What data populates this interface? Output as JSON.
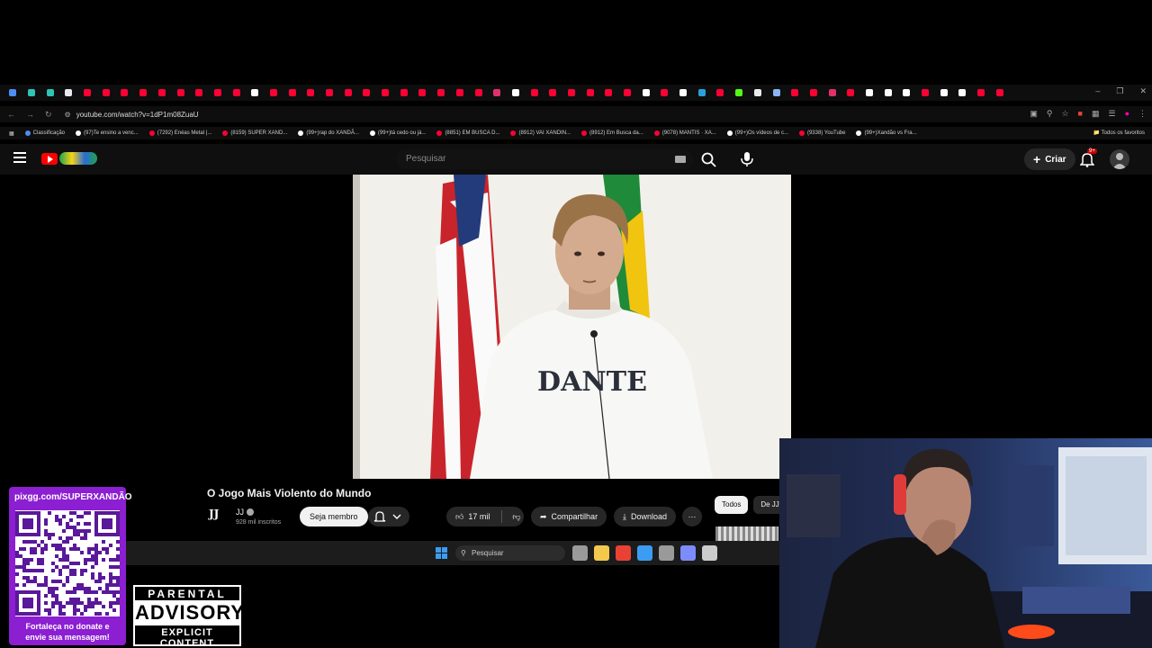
{
  "browser": {
    "url": "youtube.com/watch?v=1dP1m08ZuaU",
    "tab_favicon_colors": [
      "#4d8df5",
      "#2ec4b6",
      "#2ec4b6",
      "#e8eaed",
      "#ff0033",
      "#ff0033",
      "#ff0033",
      "#ff0033",
      "#ff0033",
      "#ff0033",
      "#ff0033",
      "#ff0033",
      "#ff0033",
      "#ffffff",
      "#ff0033",
      "#ff0033",
      "#ff0033",
      "#ff0033",
      "#ff0033",
      "#ff0033",
      "#ff0033",
      "#ff0033",
      "#ff0033",
      "#ff0033",
      "#ff0033",
      "#ff0033",
      "#e1306c",
      "#ffffff",
      "#ff0033",
      "#ff0033",
      "#ff0033",
      "#ff0033",
      "#ff0033",
      "#ff0033",
      "#ffffff",
      "#ff0033",
      "#ffffff",
      "#2aa1da",
      "#ff0033",
      "#53fc18",
      "#e8eaed",
      "#8ab4f8",
      "#ff0033",
      "#ff0033",
      "#e1306c",
      "#ff0033",
      "#ffffff",
      "#ffffff",
      "#ffffff",
      "#ff0033",
      "#ffffff",
      "#ffffff",
      "#ff0033",
      "#ff0033"
    ],
    "bookmarks": [
      {
        "label": "Classificação",
        "color": "#4d8df5"
      },
      {
        "label": "(97)Te ensino a venc...",
        "color": "#ffffff"
      },
      {
        "label": "(7292) Enéas Metal |...",
        "color": "#ff0033"
      },
      {
        "label": "(8159) SUPER XAND...",
        "color": "#ff0033"
      },
      {
        "label": "(99+)rap do XANDÃ...",
        "color": "#ffffff"
      },
      {
        "label": "(99+)tá cedo ou já...",
        "color": "#ffffff"
      },
      {
        "label": "(8851) EM BUSCA D...",
        "color": "#ff0033"
      },
      {
        "label": "(8912) VAI XANDIN...",
        "color": "#ff0033"
      },
      {
        "label": "(8912) Em Busca da...",
        "color": "#ff0033"
      },
      {
        "label": "(9078) MANTIS · XA...",
        "color": "#ff0033"
      },
      {
        "label": "(99+)Os vídeos de c...",
        "color": "#ffffff"
      },
      {
        "label": "(9338) YouTube",
        "color": "#ff0033"
      },
      {
        "label": "(99+)Xandão vs Fra...",
        "color": "#ffffff"
      }
    ],
    "all_bookmarks_label": "Todos os favoritos"
  },
  "youtube": {
    "search_placeholder": "Pesquisar",
    "create_label": "Criar",
    "notification_badge": "9+",
    "video": {
      "title": "O Jogo Mais Violento do Mundo",
      "shirt_text": "DANTE",
      "channel": "JJ",
      "channel_logo": "JJ",
      "subscribers": "928 mil inscritos",
      "member_label": "Seja membro",
      "likes": "17 mil",
      "share_label": "Compartilhar",
      "download_label": "Download"
    },
    "chips": [
      "Todos",
      "De JJ"
    ]
  },
  "taskbar": {
    "search_placeholder": "Pesquisar",
    "icon_colors": [
      "#9a9a9a",
      "#f2c94c",
      "#e94235",
      "#3b9cf2",
      "#9a9a9a",
      "#7c8cff",
      "#cccccc"
    ]
  },
  "overlay": {
    "donate_url": "pixgg.com/SUPERXANDÃO",
    "donate_message_1": "Fortaleça no donate e",
    "donate_message_2": "envie sua mensagem!",
    "advisory_1": "PARENTAL",
    "advisory_2": "ADVISORY",
    "advisory_3": "EXPLICIT CONTENT"
  },
  "colors": {
    "youtube_red": "#ff0000",
    "background": "#0f0f0f",
    "qr_panel": "#8b1fd1"
  }
}
